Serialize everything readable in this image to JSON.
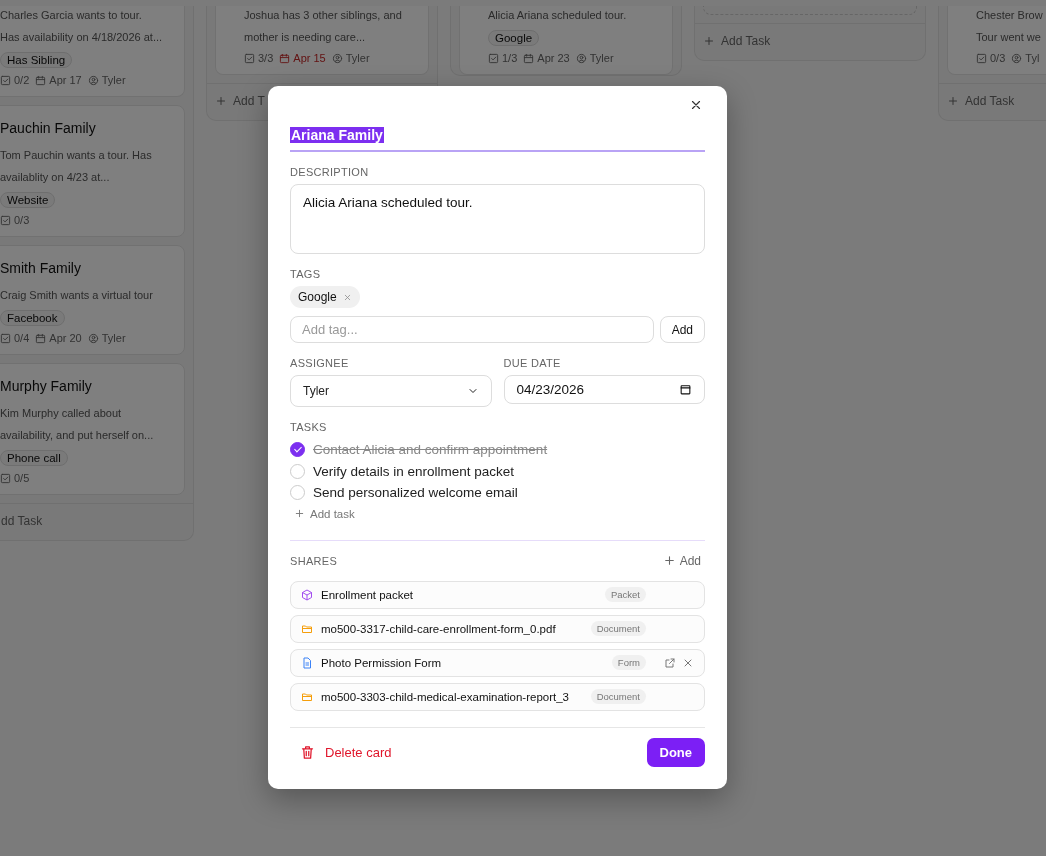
{
  "board": {
    "columns": [
      {
        "cards": [
          {
            "lines": [
              "Charles Garcia wants to tour.",
              "Has availability on 4/18/2026 at..."
            ],
            "tag": "Has Sibling",
            "tasks": "0/2",
            "date": "Apr 17",
            "overdue": false,
            "assignee": "Tyler"
          },
          {
            "title": "Pauchin Family",
            "lines": [
              "Tom Pauchin wants a tour. Has",
              "availablity on 4/23 at..."
            ],
            "tag": "Website",
            "tasks": "0/3"
          },
          {
            "title": "Smith Family",
            "lines": [
              "Craig Smith wants a virtual tour"
            ],
            "tag": "Facebook",
            "tasks": "0/4",
            "date": "Apr 20",
            "overdue": false,
            "assignee": "Tyler"
          },
          {
            "title": "Murphy Family",
            "lines": [
              "Kim Murphy called about",
              "availability, and put herself on..."
            ],
            "tag": "Phone call",
            "tasks": "0/5"
          }
        ],
        "add": {
          "label": "dd Task",
          "plus": false
        }
      },
      {
        "cards": [
          {
            "lines": [
              "Joshua has 3 other siblings, and",
              "mother is needing care..."
            ],
            "tasks": "3/3",
            "date": "Apr 15",
            "overdue": true,
            "assignee": "Tyler"
          }
        ],
        "add": {
          "label": "Add T",
          "plus": true
        }
      },
      {
        "cards": [
          {
            "lines": [
              "Alicia Ariana scheduled tour."
            ],
            "tag": "Google",
            "tasks": "1/3",
            "date": "Apr 23",
            "overdue": false,
            "assignee": "Tyler"
          }
        ]
      },
      {
        "dropzone": true,
        "add": {
          "label": "Add Task",
          "plus": true
        }
      },
      {
        "cards": [
          {
            "lines": [
              "Chester Brow",
              "Tour went we"
            ],
            "tasks": "0/3",
            "assignee": "Tyl"
          }
        ],
        "add": {
          "label": "Add Task",
          "plus": true
        }
      }
    ]
  },
  "modal": {
    "title": "Ariana Family",
    "title_selected": true,
    "description": {
      "label": "DESCRIPTION",
      "value": "Alicia Ariana scheduled tour."
    },
    "tags": {
      "label": "TAGS",
      "items": [
        {
          "label": "Google"
        }
      ],
      "placeholder": "Add tag...",
      "add_button": "Add"
    },
    "assignee": {
      "label": "ASSIGNEE",
      "value": "Tyler"
    },
    "due_date": {
      "label": "DUE DATE",
      "value": "04/23/2026"
    },
    "tasks": {
      "label": "TASKS",
      "items": [
        {
          "label": "Contact Alicia and confirm appointment",
          "checked": true
        },
        {
          "label": "Verify details in enrollment packet",
          "checked": false
        },
        {
          "label": "Send personalized welcome email",
          "checked": false
        }
      ],
      "add_label": "Add task"
    },
    "shares": {
      "label": "SHARES",
      "add_label": "Add",
      "items": [
        {
          "kind": "packet",
          "name": "Enrollment packet",
          "badge": "Packet",
          "actions": false
        },
        {
          "kind": "document",
          "name": "mo500-3317-child-care-enrollment-form_0.pdf",
          "badge": "Document",
          "actions": false
        },
        {
          "kind": "form",
          "name": "Photo Permission Form",
          "badge": "Form",
          "actions": true
        },
        {
          "kind": "document",
          "name": "mo500-3303-child-medical-examination-report_3",
          "badge": "Document",
          "actions": false
        }
      ]
    },
    "delete_label": "Delete card",
    "done_label": "Done"
  }
}
